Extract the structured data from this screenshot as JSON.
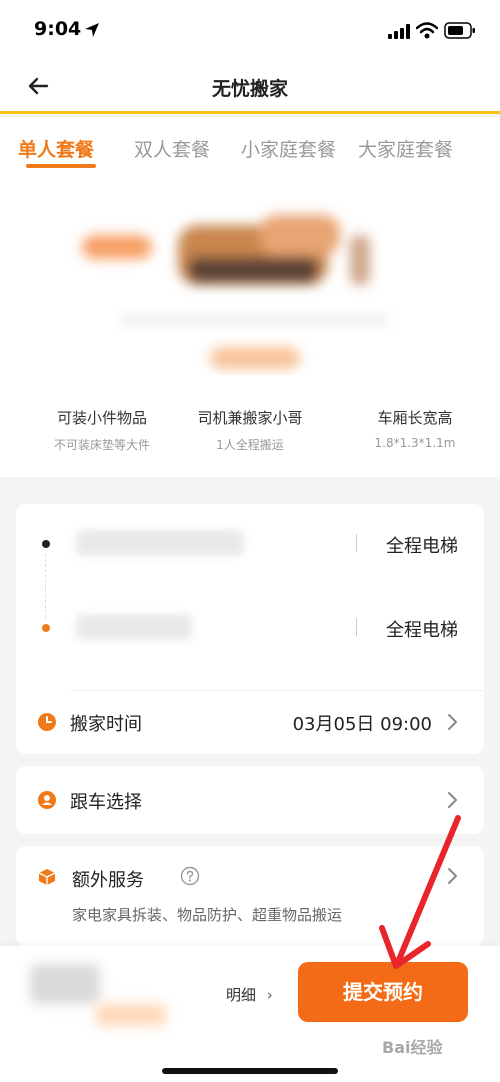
{
  "status": {
    "time": "9:04"
  },
  "nav": {
    "title": "无忧搬家"
  },
  "tabs": [
    {
      "label": "单人套餐",
      "active": true
    },
    {
      "label": "双人套餐",
      "active": false
    },
    {
      "label": "小家庭套餐",
      "active": false
    },
    {
      "label": "大家庭套餐",
      "active": false
    }
  ],
  "features": [
    {
      "title": "可装小件物品",
      "sub": "不可装床垫等大件"
    },
    {
      "title": "司机兼搬家小哥",
      "sub": "1人全程搬运"
    },
    {
      "title": "车厢长宽高",
      "sub": "1.8*1.3*1.1m"
    }
  ],
  "address": {
    "origin_elevator": "全程电梯",
    "destination_elevator": "全程电梯"
  },
  "moving_time": {
    "label": "搬家时间",
    "value": "03月05日 09:00"
  },
  "follow_car": {
    "label": "跟车选择"
  },
  "extra_service": {
    "label": "额外服务",
    "desc": "家电家具拆装、物品防护、超重物品搬运"
  },
  "bottom": {
    "detail_label": "明细",
    "submit_label": "提交预约"
  },
  "watermark": "Bai经验",
  "colors": {
    "accent": "#f07a1a",
    "button": "#f36b16",
    "nav_border": "#f5c518",
    "annotation": "#e8242c"
  }
}
